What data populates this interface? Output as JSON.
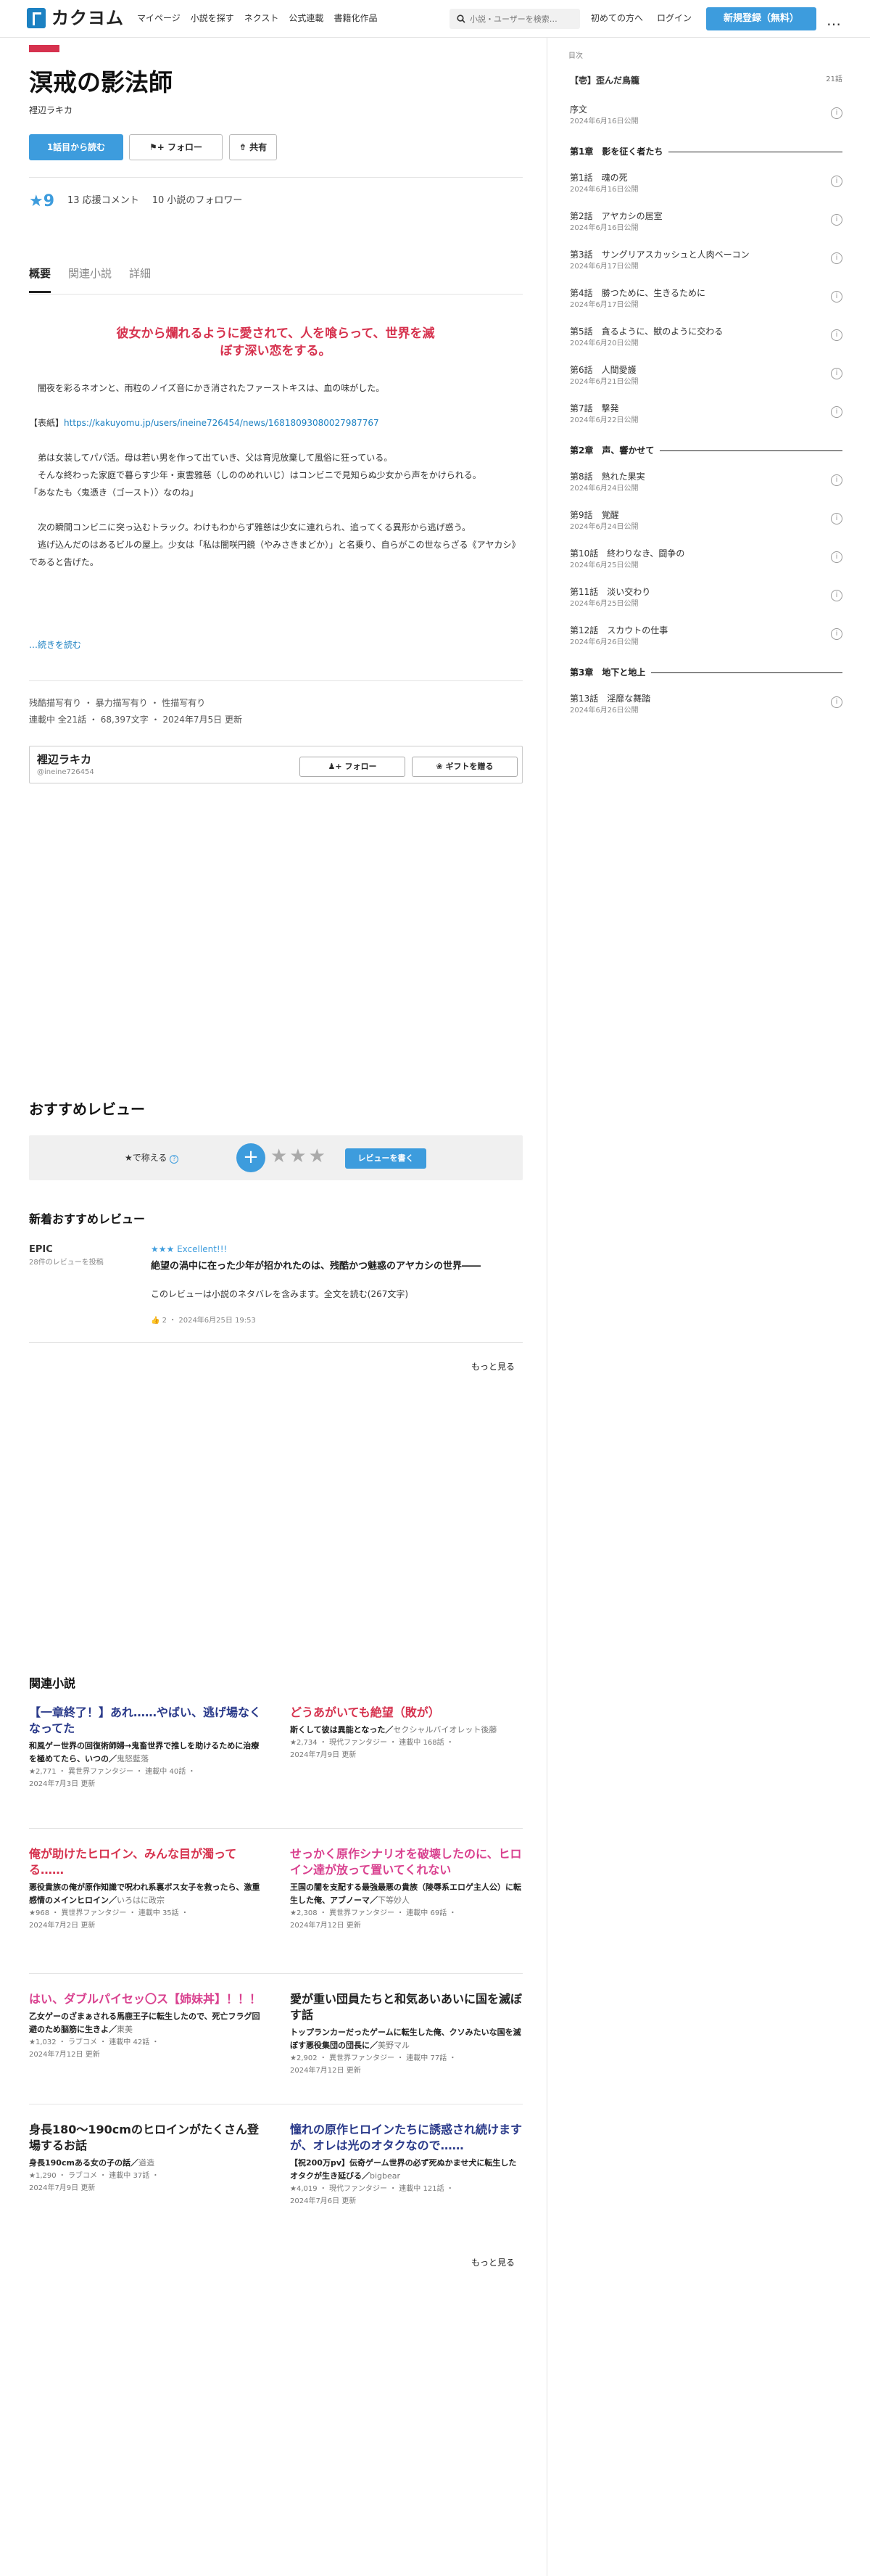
{
  "header": {
    "logo": "カクヨム",
    "nav": [
      "マイページ",
      "小説を探す",
      "ネクスト",
      "公式連載",
      "書籍化作品"
    ],
    "search_placeholder": "小説・ユーザーを検索…",
    "for_beginners": "初めての方へ",
    "login": "ログイン",
    "register": "新規登録（無料）",
    "menu": "…"
  },
  "work": {
    "title": "溟戒の影法師",
    "author": "裡辺ラキカ",
    "read_first": "1話目から読む",
    "follow": "フォロー",
    "share": "共有",
    "stars": "★9",
    "comments": "13 応援コメント",
    "followers": "10 小説のフォロワー",
    "tabs": [
      "概要",
      "関連小説",
      "詳細"
    ],
    "catchcopy": "彼女から爛れるように愛されて、人を喰らって、世界を滅ぼす深い恋をする。",
    "intro_p1": "　闇夜を彩るネオンと、雨粒のノイズ音にかき消されたファーストキスは、血の味がした。",
    "intro_link_label": "【表紙】",
    "intro_link": "https://kakuyomu.jp/users/ineine726454/news/16818093080027987767",
    "intro_p3": "　弟は女装してパパ活。母は若い男を作って出ていき、父は育児放棄して風俗に狂っている。\n　そんな終わった家庭で暮らす少年・東雲雅慈（しののめれいじ）はコンビニで見知らぬ少女から声をかけられる。\n「あなたも〈鬼憑き（ゴースト）〉なのね」",
    "intro_p4": "　次の瞬間コンビニに突っ込むトラック。わけもわからず雅慈は少女に連れられ、追ってくる異形から逃げ惑う。\n　逃げ込んだのはあるビルの屋上。少女は「私は闇咲円鏡（やみさきまどか）」と名乗り、自らがこの世ならざる《アヤカシ》であると告げた。",
    "read_more": "…続きを読む",
    "tags": "残酷描写有り ・ 暴力描写有り ・ 性描写有り",
    "meta": "連載中 全21話 ・ 68,397文字 ・ 2024年7月5日 更新"
  },
  "author_box": {
    "name": "裡辺ラキカ",
    "id": "@ineine726454",
    "follow": "フォロー",
    "gift": "ギフトを贈る"
  },
  "reviews": {
    "heading": "おすすめレビュー",
    "rate_label": "★で称える",
    "plus": "+",
    "stars": "★★★",
    "write": "レビューを書く",
    "new_heading": "新着おすすめレビュー",
    "user": "EPIC",
    "user_count": "28件のレビューを投稿",
    "rating": "★★★ Excellent!!!",
    "title": "絶望の渦中に在った少年が招かれたのは、残酷かつ魅惑のアヤカシの世界――",
    "body": "このレビューは小説のネタバレを含みます。全文を読む(267文字)",
    "meta": "2 ・ 2024年6月25日 19:53",
    "more": "もっと見る"
  },
  "related": {
    "heading": "関連小説",
    "more": "もっと見る",
    "items": [
      {
        "title": "【一章終了！】あれ……やばい、逃げ場なくなってた",
        "color": "#2a3a8a",
        "catch": "和風ゲー世界の回復術師婦→鬼畜世界で推しを助けるために治療を極めてたら、いつの",
        "author": "鬼怒藍落",
        "meta1": "★2,771 ・ 異世界ファンタジー ・ 連載中 40話 ・",
        "meta2": "2024年7月3日 更新"
      },
      {
        "title": "どうあがいても絶望（敗が）",
        "color": "#d6324e",
        "catch": "斯くして彼は異能となった",
        "author": "セクシャルバイオレット後藤",
        "meta1": "★2,734 ・ 現代ファンタジー ・ 連載中 168話 ・",
        "meta2": "2024年7月9日 更新"
      },
      {
        "title": "俺が助けたヒロイン、みんな目が濁ってる……",
        "color": "#d6324e",
        "catch": "悪役貴族の俺が原作知識で呪われ系裏ボス女子を救ったら、激重感情のメインヒロイン",
        "author": "いろはに政宗",
        "meta1": "★968 ・ 異世界ファンタジー ・ 連載中 35話 ・",
        "meta2": "2024年7月2日 更新"
      },
      {
        "title": "せっかく原作シナリオを破壊したのに、ヒロイン達が放って置いてくれない",
        "color": "#d9418f",
        "catch": "王国の闇を支配する最強最悪の貴族（陵辱系エロゲ主人公）に転生した俺、アブノーマ",
        "author": "下等妙人",
        "meta1": "★2,308 ・ 異世界ファンタジー ・ 連載中 69話 ・",
        "meta2": "2024年7月12日 更新"
      },
      {
        "title": "はい、ダブルパイセッ〇ス【姉妹丼】！！！",
        "color": "#d9418f",
        "catch": "乙女ゲーのざまぁされる馬鹿王子に転生したので、死亡フラグ回避のため脳筋に生きよ",
        "author": "東美",
        "meta1": "★1,032 ・ ラブコメ ・ 連載中 42話 ・",
        "meta2": "2024年7月12日 更新"
      },
      {
        "title": "愛が重い団員たちと和気あいあいに国を滅ぼす話",
        "color": "#222222",
        "catch": "トップランカーだったゲームに転生した俺、クソみたいな国を滅ぼす悪役集団の団長に",
        "author": "美野マル",
        "meta1": "★2,902 ・ 異世界ファンタジー ・ 連載中 77話 ・",
        "meta2": "2024年7月12日 更新"
      },
      {
        "title": "身長180〜190cmのヒロインがたくさん登場するお話",
        "color": "#222222",
        "catch": "身長190cmある女の子の話",
        "author": "道造",
        "meta1": "★1,290 ・ ラブコメ ・ 連載中 37話 ・",
        "meta2": "2024年7月9日 更新"
      },
      {
        "title": "憧れの原作ヒロインたちに誘惑され続けますが、オレは光のオタクなので……",
        "color": "#2a3a8a",
        "catch": "【祝200万pv】伝奇ゲーム世界の必ず死ぬかませ犬に転生したオタクが生き延びる",
        "author": "bigbear",
        "meta1": "★4,019 ・ 現代ファンタジー ・ 連載中 121話 ・",
        "meta2": "2024年7月6日 更新"
      }
    ]
  },
  "toc": {
    "heading": "目次",
    "title": "【壱】歪んだ鳥籠",
    "count": "21話",
    "prologue": {
      "name": "序文",
      "date": "2024年6月16日公開"
    },
    "chapters": [
      {
        "name": "第1章　影を征く者たち",
        "episodes": [
          {
            "name": "第1話　魂の死",
            "date": "2024年6月16日公開"
          },
          {
            "name": "第2話　アヤカシの居室",
            "date": "2024年6月16日公開"
          },
          {
            "name": "第3話　サングリアスカッシュと人肉ベーコン",
            "date": "2024年6月17日公開"
          },
          {
            "name": "第4話　勝つために、生きるために",
            "date": "2024年6月17日公開"
          },
          {
            "name": "第5話　貪るように、獣のように交わる",
            "date": "2024年6月20日公開"
          },
          {
            "name": "第6話　人間愛護",
            "date": "2024年6月21日公開"
          },
          {
            "name": "第7話　撃発",
            "date": "2024年6月22日公開"
          }
        ]
      },
      {
        "name": "第2章　声、響かせて",
        "episodes": [
          {
            "name": "第8話　熟れた果実",
            "date": "2024年6月24日公開"
          },
          {
            "name": "第9話　覚醒",
            "date": "2024年6月24日公開"
          },
          {
            "name": "第10話　終わりなき、闘争の",
            "date": "2024年6月25日公開"
          },
          {
            "name": "第11話　淡い交わり",
            "date": "2024年6月25日公開"
          },
          {
            "name": "第12話　スカウトの仕事",
            "date": "2024年6月26日公開"
          }
        ]
      },
      {
        "name": "第3章　地下と地上",
        "episodes": [
          {
            "name": "第13話　淫靡な舞踏",
            "date": "2024年6月26日公開"
          }
        ]
      }
    ]
  }
}
